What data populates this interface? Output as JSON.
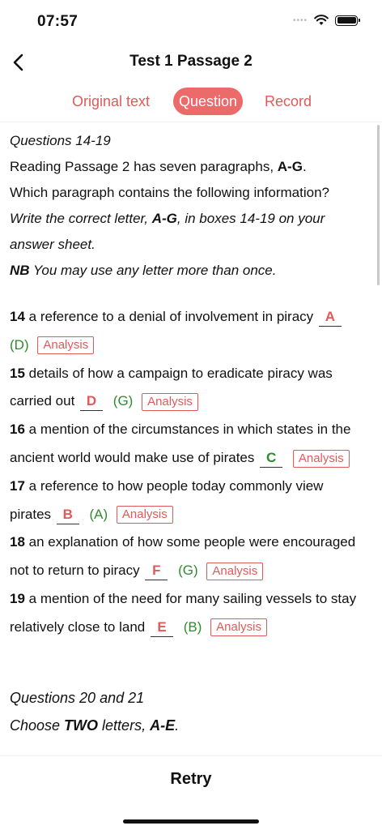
{
  "status_bar": {
    "time": "07:57",
    "signal": "••••"
  },
  "nav": {
    "title": "Test 1  Passage 2"
  },
  "tabs": [
    {
      "label": "Original text",
      "active": false
    },
    {
      "label": "Question",
      "active": true
    },
    {
      "label": "Record",
      "active": false
    }
  ],
  "intro": {
    "heading": "Questions 14-19",
    "line1_pre": "Reading Passage 2 has seven paragraphs, ",
    "line1_bold": "A-G",
    "line1_post": ".",
    "line2": "Which paragraph contains the following information?",
    "line3_pre": "Write the correct letter, ",
    "line3_bold": "A-G",
    "line3_post": ", in boxes 14-19 on your",
    "line4": "answer sheet.",
    "nb_bold": "NB",
    "nb_text": " You may use any letter more than once."
  },
  "analysis_label": "Analysis",
  "questions": [
    {
      "num": "14",
      "text1": " a reference to a denial of involvement in piracy",
      "answer": "A",
      "correct": "(D)"
    },
    {
      "num": "15",
      "text1": " details of how a campaign to eradicate piracy was",
      "text2": "carried out",
      "answer": "D",
      "correct": "(G)"
    },
    {
      "num": "16",
      "text1": " a mention of the circumstances in which states in the",
      "text2": "ancient world would make use of pirates",
      "answer": "C",
      "correct": ""
    },
    {
      "num": "17",
      "text1": " a reference to how people today commonly view",
      "text2": "pirates",
      "answer": "B",
      "correct": "(A)"
    },
    {
      "num": "18",
      "text1": " an explanation of how some people were encouraged",
      "text2": "not to return to piracy",
      "answer": "F",
      "correct": "(G)"
    },
    {
      "num": "19",
      "text1": " a mention of the need for many sailing vessels to stay",
      "text2": "relatively close to land",
      "answer": "E",
      "correct": "(B)"
    }
  ],
  "next_section": {
    "heading": "Questions 20 and 21",
    "line_pre": "Choose ",
    "line_bold1": "TWO",
    "line_mid": " letters, ",
    "line_bold2": "A-E",
    "line_post": "."
  },
  "bottom": {
    "retry_label": "Retry"
  },
  "colors": {
    "accent": "#e05a5a",
    "accent_fill": "#ec6a6a",
    "correct": "#2e8b2e"
  }
}
